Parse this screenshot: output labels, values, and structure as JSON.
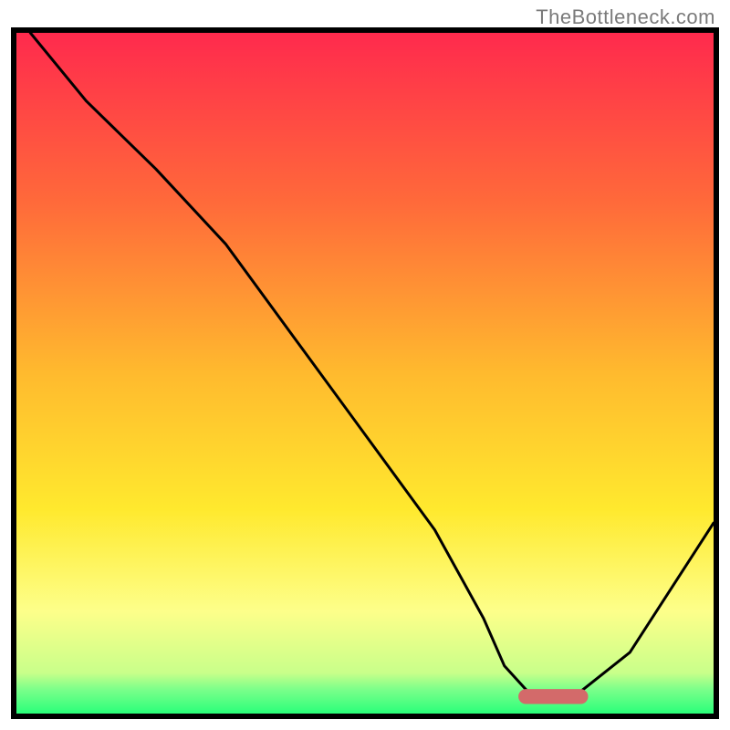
{
  "watermark": "TheBottleneck.com",
  "chart_data": {
    "type": "line",
    "title": "",
    "xlabel": "",
    "ylabel": "",
    "xlim": [
      0,
      100
    ],
    "ylim": [
      0,
      100
    ],
    "grid": false,
    "legend": "none",
    "series": [
      {
        "name": "bottleneck-curve",
        "color": "#000000",
        "x": [
          2,
          10,
          20,
          30,
          40,
          50,
          60,
          67,
          70,
          74,
          80,
          88,
          100
        ],
        "y": [
          100,
          90,
          80,
          69,
          55,
          41,
          27,
          14,
          7,
          2.5,
          2.5,
          9,
          28
        ]
      }
    ],
    "marker": {
      "name": "optimal-range",
      "color": "#d36a6a",
      "x_center": 77,
      "y": 2.5,
      "width": 10,
      "height": 2.2
    },
    "background_gradient": {
      "stops": [
        {
          "offset": 0.0,
          "color": "#ff2a4d"
        },
        {
          "offset": 0.25,
          "color": "#ff6a3a"
        },
        {
          "offset": 0.5,
          "color": "#ffba2e"
        },
        {
          "offset": 0.7,
          "color": "#ffe92e"
        },
        {
          "offset": 0.85,
          "color": "#fdff8a"
        },
        {
          "offset": 0.94,
          "color": "#c9ff8a"
        },
        {
          "offset": 0.965,
          "color": "#7aff8a"
        },
        {
          "offset": 1.0,
          "color": "#2aff7a"
        }
      ]
    },
    "annotations": []
  }
}
